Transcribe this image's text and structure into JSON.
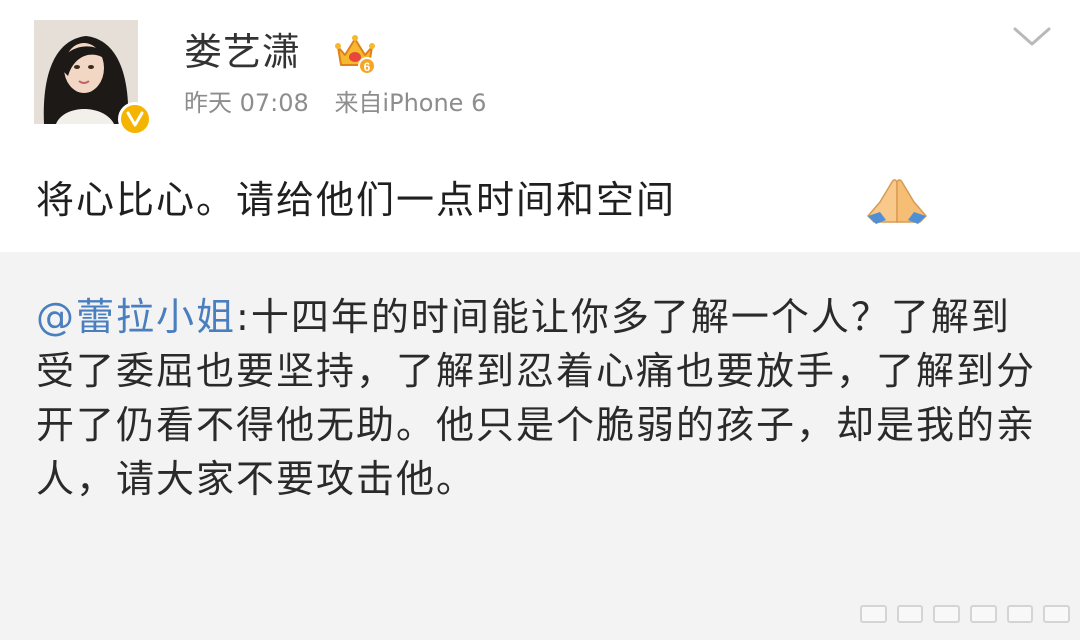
{
  "user": {
    "name": "娄艺潇",
    "vip_level": "6"
  },
  "meta": {
    "time": "昨天 07:08",
    "source": "来自iPhone 6"
  },
  "post": {
    "text": "将心比心。请给他们一点时间和空间"
  },
  "repost": {
    "mention": "@蕾拉小姐",
    "separator": ":",
    "text": "十四年的时间能让你多了解一个人？了解到受了委屈也要坚持，了解到忍着心痛也要放手，了解到分开了仍看不得他无助。他只是个脆弱的孩子，却是我的亲人，请大家不要攻击他。"
  },
  "icons": {
    "avatar": "avatar-icon",
    "verified": "verified-v-icon",
    "crown": "crown-icon",
    "dropdown": "chevron-down-icon",
    "emoji": "praying-hands-icon"
  },
  "colors": {
    "mention": "#4a7fbf",
    "verified_badge": "#f4b400",
    "meta_text": "#8d8d8d",
    "repost_bg": "#f3f3f4"
  }
}
